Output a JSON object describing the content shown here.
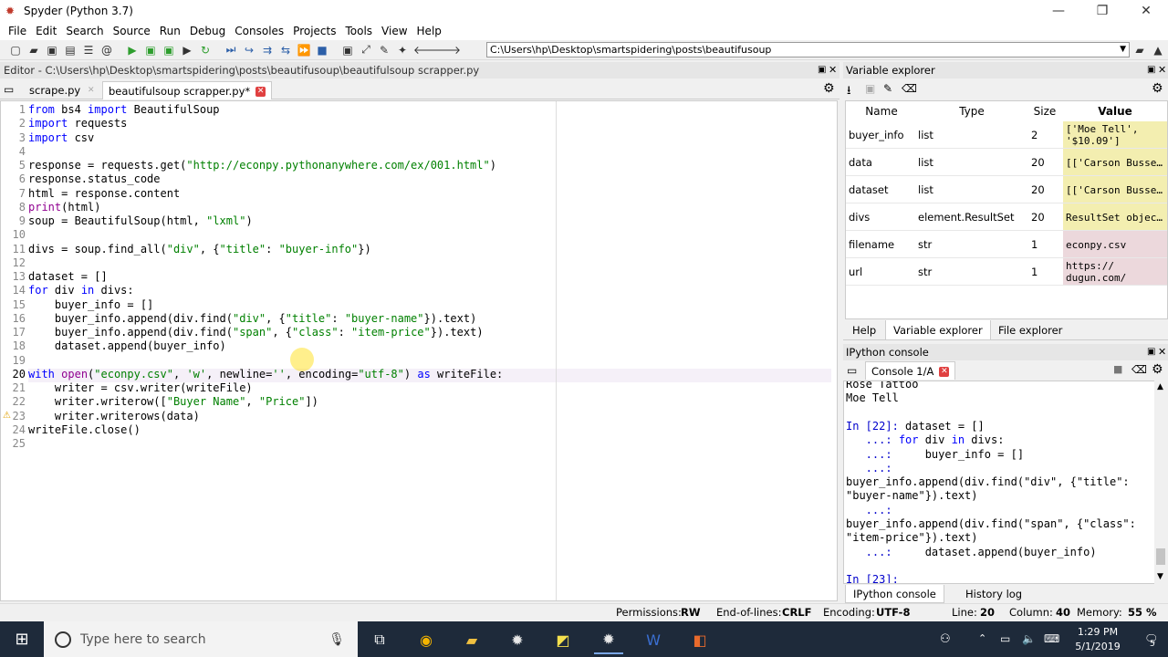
{
  "window": {
    "title": "Spyder (Python 3.7)",
    "minimize": "—",
    "maximize": "❐",
    "close": "✕"
  },
  "menu": [
    "File",
    "Edit",
    "Search",
    "Source",
    "Run",
    "Debug",
    "Consoles",
    "Projects",
    "Tools",
    "View",
    "Help"
  ],
  "toolbar": {
    "path": "C:\\Users\\hp\\Desktop\\smartspidering\\posts\\beautifusoup"
  },
  "editor": {
    "header": "Editor - C:\\Users\\hp\\Desktop\\smartspidering\\posts\\beautifusoup\\beautifulsoup scrapper.py",
    "tabs": [
      "scrape.py",
      "beautifulsoup scrapper.py*"
    ],
    "line_numbers": [
      "1",
      "2",
      "3",
      "4",
      "5",
      "6",
      "7",
      "8",
      "9",
      "10",
      "11",
      "12",
      "13",
      "14",
      "15",
      "16",
      "17",
      "18",
      "19",
      "20",
      "21",
      "22",
      "23",
      "24",
      "25"
    ],
    "lines": [
      "from bs4 import BeautifulSoup",
      "import requests",
      "import csv",
      "",
      "response = requests.get(\"http://econpy.pythonanywhere.com/ex/001.html\")",
      "response.status_code",
      "html = response.content",
      "print(html)",
      "soup = BeautifulSoup(html, \"lxml\")",
      "",
      "divs = soup.find_all(\"div\", {\"title\": \"buyer-info\"})",
      "",
      "dataset = []",
      "for div in divs:",
      "    buyer_info = []",
      "    buyer_info.append(div.find(\"div\", {\"title\": \"buyer-name\"}).text)",
      "    buyer_info.append(div.find(\"span\", {\"class\": \"item-price\"}).text)",
      "    dataset.append(buyer_info)",
      "",
      "with open(\"econpy.csv\", 'w', newline='', encoding=\"utf-8\") as writeFile:",
      "    writer = csv.writer(writeFile)",
      "    writer.writerow([\"Buyer Name\", \"Price\"])",
      "    writer.writerows(data)",
      "writeFile.close()",
      ""
    ]
  },
  "variable_explorer": {
    "header": "Variable explorer",
    "columns": [
      "Name",
      "Type",
      "Size",
      "Value"
    ],
    "rows": [
      {
        "name": "buyer_info",
        "type": "list",
        "size": "2",
        "value": "['Moe Tell', '$10.09']",
        "color": "#f3eeb0"
      },
      {
        "name": "data",
        "type": "list",
        "size": "20",
        "value": "[['Carson Busse…",
        "color": "#f3eeb0"
      },
      {
        "name": "dataset",
        "type": "list",
        "size": "20",
        "value": "[['Carson Busse…",
        "color": "#f3eeb0"
      },
      {
        "name": "divs",
        "type": "element.ResultSet",
        "size": "20",
        "value": "ResultSet objec…",
        "color": "#f3eeb0"
      },
      {
        "name": "filename",
        "type": "str",
        "size": "1",
        "value": "econpy.csv",
        "color": "#ecd8dc"
      },
      {
        "name": "url",
        "type": "str",
        "size": "1",
        "value": "https:// dugun.com/",
        "color": "#ecd8dc"
      }
    ],
    "tabs": [
      "Help",
      "Variable explorer",
      "File explorer"
    ]
  },
  "ipython": {
    "header": "IPython console",
    "tab": "Console 1/A",
    "lines": [
      {
        "text": "Rose Tattoo",
        "prompt": false
      },
      {
        "text": "Moe Tell",
        "prompt": false
      },
      {
        "text": "",
        "prompt": false
      },
      {
        "text": "In [22]: dataset = []",
        "prompt": true
      },
      {
        "text": "   ...: for div in divs:",
        "prompt": true
      },
      {
        "text": "   ...:     buyer_info = []",
        "prompt": true
      },
      {
        "text": "   ...:",
        "prompt": true
      },
      {
        "text": "buyer_info.append(div.find(\"div\", {\"title\":",
        "prompt": false
      },
      {
        "text": "\"buyer-name\"}).text)",
        "prompt": false
      },
      {
        "text": "   ...:",
        "prompt": true
      },
      {
        "text": "buyer_info.append(div.find(\"span\", {\"class\":",
        "prompt": false
      },
      {
        "text": "\"item-price\"}).text)",
        "prompt": false
      },
      {
        "text": "   ...:     dataset.append(buyer_info)",
        "prompt": true
      },
      {
        "text": "",
        "prompt": false
      },
      {
        "text": "In [23]:",
        "prompt": true
      }
    ],
    "bottom_tabs": [
      "IPython console",
      "History log"
    ]
  },
  "statusbar": {
    "permissions_label": "Permissions:",
    "permissions": "RW",
    "eol_label": "End-of-lines:",
    "eol": "CRLF",
    "encoding_label": "Encoding:",
    "encoding": "UTF-8",
    "line_label": "Line:",
    "line": "20",
    "column_label": "Column:",
    "column": "40",
    "memory_label": "Memory:",
    "memory": "55 %"
  },
  "taskbar": {
    "search_placeholder": "Type here to search",
    "time": "1:29 PM",
    "date": "5/1/2019",
    "notifications": "5"
  }
}
